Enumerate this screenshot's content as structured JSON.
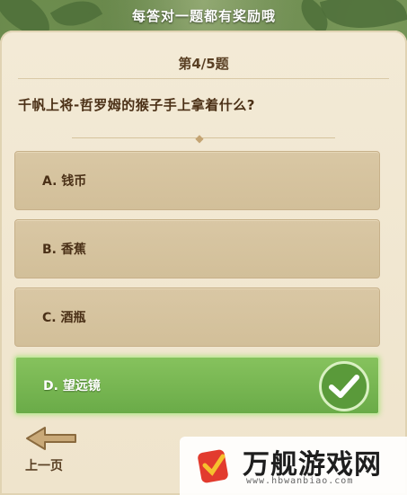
{
  "banner": {
    "text": "每答对一题都有奖励哦"
  },
  "quiz": {
    "question_number": "第4/5题",
    "question": "千帆上将-哲罗姆的猴子手上拿着什么?",
    "options": [
      {
        "label": "A. 钱币",
        "correct": false
      },
      {
        "label": "B. 香蕉",
        "correct": false
      },
      {
        "label": "C. 酒瓶",
        "correct": false
      },
      {
        "label": "D. 望远镜",
        "correct": true
      }
    ]
  },
  "nav": {
    "prev_label": "上一页"
  },
  "watermark": {
    "title": "万舰游戏网",
    "url": "www.hbwanbiao.com"
  },
  "colors": {
    "correct": "#6aab48",
    "option": "#d9c7a4",
    "parchment": "#f3ead6"
  },
  "icons": {
    "correct": "checkmark-icon",
    "prev": "arrow-left-icon"
  }
}
